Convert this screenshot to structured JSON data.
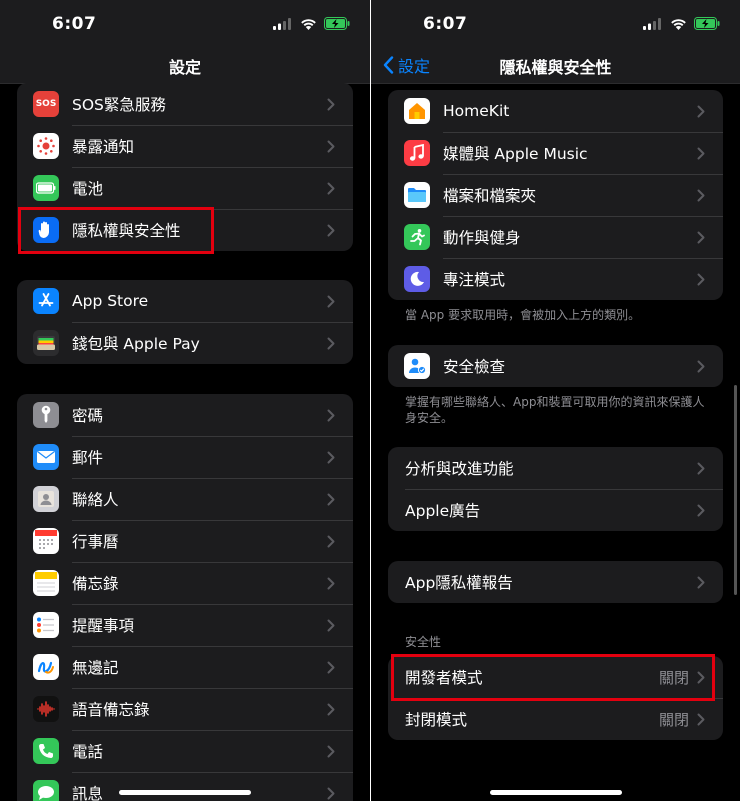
{
  "status_bar": {
    "time_left": "6:07",
    "time_right": "6:07"
  },
  "left": {
    "nav_title": "設定",
    "group1": [
      {
        "label": "SOS緊急服務",
        "icon": "sos-icon",
        "color": "#e5413a",
        "glyph": "SOS"
      },
      {
        "label": "暴露通知",
        "icon": "exposure-notification-icon",
        "color": "#ffffff"
      },
      {
        "label": "電池",
        "icon": "battery-icon",
        "color": "#34c759"
      },
      {
        "label": "隱私權與安全性",
        "icon": "privacy-hand-icon",
        "color": "#0a6cf5"
      }
    ],
    "group2": [
      {
        "label": "App Store",
        "icon": "app-store-icon",
        "color": "#0a84ff"
      },
      {
        "label": "錢包與 Apple Pay",
        "icon": "wallet-icon",
        "color": "#1c1c1e"
      }
    ],
    "group3": [
      {
        "label": "密碼",
        "icon": "key-icon",
        "color": "#8e8e93"
      },
      {
        "label": "郵件",
        "icon": "mail-icon",
        "color": "#1f8cf9"
      },
      {
        "label": "聯絡人",
        "icon": "contacts-icon",
        "color": "#c7c7cc"
      },
      {
        "label": "行事曆",
        "icon": "calendar-icon",
        "color": "#ffffff"
      },
      {
        "label": "備忘錄",
        "icon": "notes-icon",
        "color": "#ffffff"
      },
      {
        "label": "提醒事項",
        "icon": "reminders-icon",
        "color": "#ffffff"
      },
      {
        "label": "無邊記",
        "icon": "freeform-icon",
        "color": "#ffffff"
      },
      {
        "label": "語音備忘錄",
        "icon": "voice-memos-icon",
        "color": "#1c1c1e"
      },
      {
        "label": "電話",
        "icon": "phone-icon",
        "color": "#34c759"
      },
      {
        "label": "訊息",
        "icon": "messages-icon",
        "color": "#34c759"
      }
    ]
  },
  "right": {
    "back_label": "設定",
    "nav_title": "隱私權與安全性",
    "group1": [
      {
        "label": "HomeKit",
        "icon": "home-icon",
        "color": "#ffffff"
      },
      {
        "label": "媒體與 Apple Music",
        "icon": "music-icon",
        "color": "#fc3c44"
      },
      {
        "label": "檔案和檔案夾",
        "icon": "files-folder-icon",
        "color": "#ffffff"
      },
      {
        "label": "動作與健身",
        "icon": "fitness-runner-icon",
        "color": "#34c759"
      },
      {
        "label": "專注模式",
        "icon": "focus-moon-icon",
        "color": "#5e5ce6"
      }
    ],
    "footnote1": "當 App 要求取用時，會被加入上方的類別。",
    "group2": [
      {
        "label": "安全檢查",
        "icon": "safety-check-icon",
        "color": "#ffffff"
      }
    ],
    "footnote2": "掌握有哪些聯絡人、App和裝置可取用你的資訊來保護人身安全。",
    "group3": [
      {
        "label": "分析與改進功能"
      },
      {
        "label": "Apple廣告"
      }
    ],
    "group4": [
      {
        "label": "App隱私權報告"
      }
    ],
    "security_header": "安全性",
    "group5": [
      {
        "label": "開發者模式",
        "value": "關閉"
      },
      {
        "label": "封閉模式",
        "value": "關閉"
      }
    ]
  }
}
